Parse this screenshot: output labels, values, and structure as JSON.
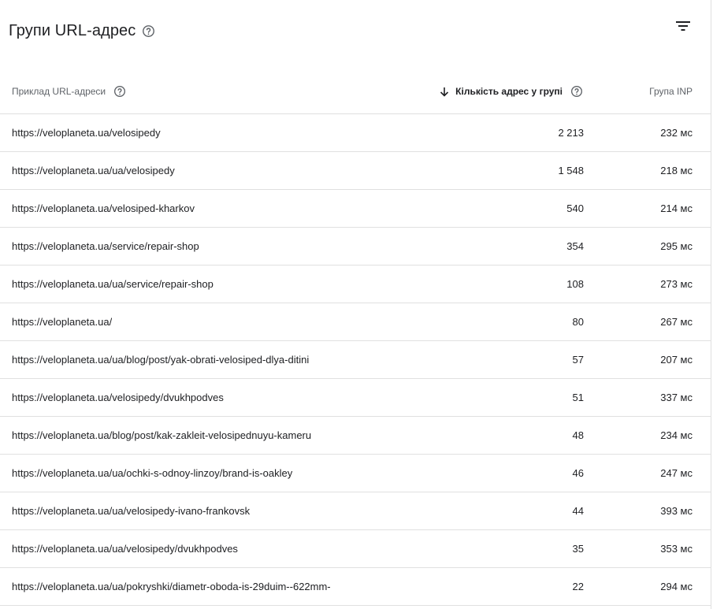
{
  "header": {
    "title": "Групи URL-адрес",
    "help_icon": "help-circle-icon",
    "filter_icon": "filter-list-icon"
  },
  "table": {
    "columns": {
      "url": "Приклад URL-адреси",
      "count": "Кількість адрес у групі",
      "inp": "Група INP"
    },
    "sort_icon": "arrow-down-icon",
    "rows": [
      {
        "url": "https://veloplaneta.ua/velosipedy",
        "count": "2 213",
        "inp": "232 мс"
      },
      {
        "url": "https://veloplaneta.ua/ua/velosipedy",
        "count": "1 548",
        "inp": "218 мс"
      },
      {
        "url": "https://veloplaneta.ua/velosiped-kharkov",
        "count": "540",
        "inp": "214 мс"
      },
      {
        "url": "https://veloplaneta.ua/service/repair-shop",
        "count": "354",
        "inp": "295 мс"
      },
      {
        "url": "https://veloplaneta.ua/ua/service/repair-shop",
        "count": "108",
        "inp": "273 мс"
      },
      {
        "url": "https://veloplaneta.ua/",
        "count": "80",
        "inp": "267 мс"
      },
      {
        "url": "https://veloplaneta.ua/ua/blog/post/yak-obrati-velosiped-dlya-ditini",
        "count": "57",
        "inp": "207 мс"
      },
      {
        "url": "https://veloplaneta.ua/velosipedy/dvukhpodves",
        "count": "51",
        "inp": "337 мс"
      },
      {
        "url": "https://veloplaneta.ua/blog/post/kak-zakleit-velosipednuyu-kameru",
        "count": "48",
        "inp": "234 мс"
      },
      {
        "url": "https://veloplaneta.ua/ua/ochki-s-odnoy-linzoy/brand-is-oakley",
        "count": "46",
        "inp": "247 мс"
      },
      {
        "url": "https://veloplaneta.ua/ua/velosipedy-ivano-frankovsk",
        "count": "44",
        "inp": "393 мс"
      },
      {
        "url": "https://veloplaneta.ua/ua/velosipedy/dvukhpodves",
        "count": "35",
        "inp": "353 мс"
      },
      {
        "url": "https://veloplaneta.ua/ua/pokryshki/diametr-oboda-is-29duim--622mm-",
        "count": "22",
        "inp": "294 мс"
      }
    ]
  },
  "colors": {
    "text": "#202124",
    "secondary_text": "#5f6368",
    "divider": "#e0e0e0"
  }
}
